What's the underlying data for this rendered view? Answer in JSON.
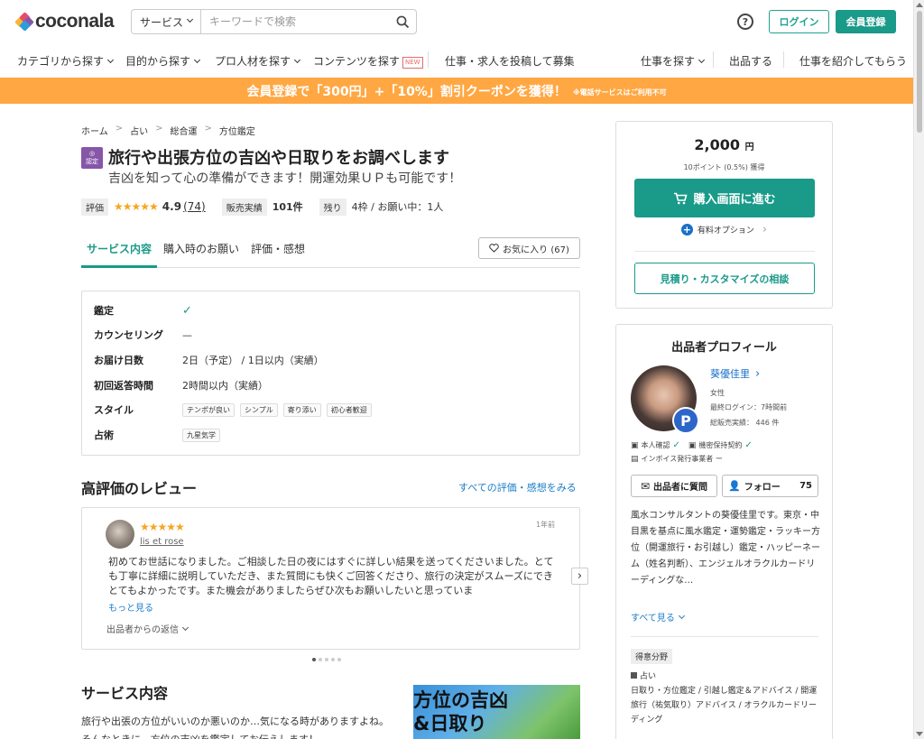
{
  "header": {
    "logo_text": "coconala",
    "search": {
      "category_label": "サービス",
      "placeholder": "キーワードで検索"
    },
    "help_glyph": "?",
    "login_label": "ログイン",
    "register_label": "会員登録"
  },
  "nav": {
    "items": [
      "カテゴリから探す",
      "目的から探す",
      "プロ人材を探す",
      "コンテンツを探す",
      "仕事・求人を投稿して募集",
      "仕事を探す",
      "出品する",
      "仕事を紹介してもらう"
    ],
    "new_badge": "NEW"
  },
  "banner": {
    "main": "会員登録で「300円」+「10%」割引クーポンを獲得！",
    "sub": "※電話サービスはご利用不可"
  },
  "breadcrumb": [
    "ホーム",
    "占い",
    "総合運",
    "方位鑑定"
  ],
  "service": {
    "badge_top": "◎",
    "badge_bottom": "認定",
    "title": "旅行や出張方位の吉凶や日取りをお調べします",
    "subtitle": "吉凶を知って心の準備ができます！開運効果ＵＰも可能です！",
    "rating_label": "評価",
    "stars": "★★★★★",
    "rating": "4.9",
    "rating_count": "(74)",
    "sales_label": "販売実績",
    "sales": "101件",
    "remain_label": "残り",
    "remain": "4枠 / お願い中：1人"
  },
  "tabs": [
    "サービス内容",
    "購入時のお願い",
    "評価・感想"
  ],
  "favorite_label": "お気に入り (67)",
  "spec": {
    "rows": [
      {
        "label": "鑑定",
        "value": "✓"
      },
      {
        "label": "カウンセリング",
        "value": "—"
      },
      {
        "label": "お届け日数",
        "value": "2日（予定） / 1日以内（実績）"
      },
      {
        "label": "初回返答時間",
        "value": "2時間以内（実績）"
      },
      {
        "label": "スタイル",
        "value": ""
      },
      {
        "label": "占術",
        "value": ""
      }
    ],
    "style_tags": [
      "テンポが良い",
      "シンプル",
      "寄り添い",
      "初心者歓迎"
    ],
    "method_tags": [
      "九星気学"
    ]
  },
  "reviews": {
    "heading": "高評価のレビュー",
    "see_all": "すべての評価・感想をみる",
    "item": {
      "stars": "★★★★★",
      "name": "lis et rose",
      "date": "1年前",
      "text": "初めてお世話になりました。ご相談した日の夜にはすぐに詳しい結果を送ってくださいました。とても丁寧に詳細に説明していただき、また質問にも快くご回答くださり、旅行の決定がスムーズにできとてもよかったです。また機会がありましたらぜひ次もお願いしたいと思っていま",
      "more": "もっと見る",
      "reply": "出品者からの返信"
    }
  },
  "service_content": {
    "heading": "サービス内容",
    "text": "旅行や出張の方位がいいのか悪いのか…気になる時がありますよね。そんなときに、方位の吉凶を鑑定してお伝えします！",
    "image_text_1": "方位の吉凶",
    "image_text_2": "&日取り"
  },
  "purchase": {
    "price": "2,000",
    "currency": "円",
    "points": "10ポイント (0.5%) 獲得",
    "buy_label": "購入画面に進む",
    "option_label": "有料オプション",
    "consult_label": "見積り・カスタマイズの相談"
  },
  "profile": {
    "heading": "出品者プロフィール",
    "badge": "P",
    "name": "葵優佳里",
    "gender": "女性",
    "last_login": "最終ログイン：7時間前",
    "total_sales": "総販売実績： 446 件",
    "verify": {
      "identity": "本人確認",
      "nda": "機密保持契約",
      "invoice": "インボイス発行事業者 ー"
    },
    "ask_label": "出品者に質問",
    "follow_label": "フォロー",
    "follow_count": "75",
    "description": "風水コンサルタントの葵優佳里です。東京・中目黒を基点に風水鑑定・運勢鑑定・ラッキー方位（開運旅行・お引越し）鑑定・ハッピーネーム（姓名判断）、エンジェルオラクルカードリーディングな…",
    "see_more": "すべて見る",
    "specialty_label": "得意分野",
    "specialty_cat": "占い",
    "specialty_list": "日取り・方位鑑定 / 引越し鑑定＆アドバイス / 開運旅行（祐気取り）アドバイス / オラクルカードリーディング"
  }
}
